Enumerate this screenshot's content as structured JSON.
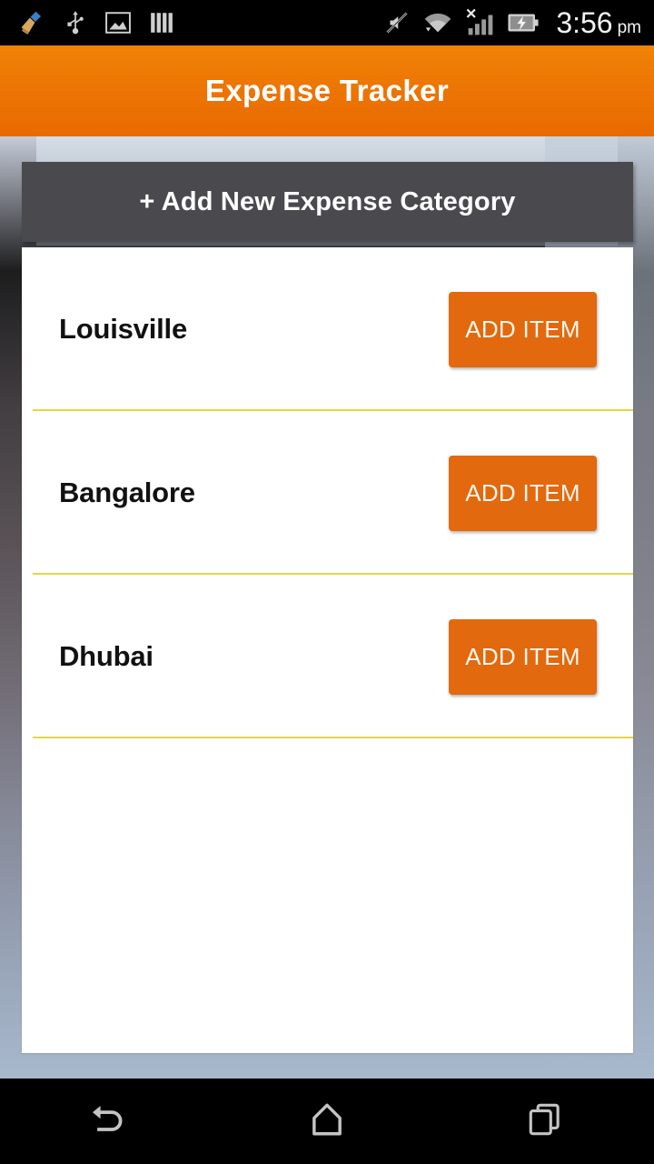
{
  "statusbar": {
    "left_icons": [
      {
        "name": "cleaner-broom-icon"
      },
      {
        "name": "usb-icon"
      },
      {
        "name": "image-gallery-icon"
      },
      {
        "name": "vertical-bars-icon"
      }
    ],
    "right_icons": [
      {
        "name": "mute-ringer-off-icon"
      },
      {
        "name": "wifi-icon"
      },
      {
        "name": "cellular-signal-no-sim-icon"
      },
      {
        "name": "battery-charging-icon"
      }
    ],
    "time": "3:56",
    "meridiem": "pm"
  },
  "appbar": {
    "title": "Expense Tracker"
  },
  "actions": {
    "add_category_label": "+ Add New Expense Category"
  },
  "categories": [
    {
      "name": "Louisville",
      "action_label": "ADD ITEM"
    },
    {
      "name": "Bangalore",
      "action_label": "ADD ITEM"
    },
    {
      "name": "Dhubai",
      "action_label": "ADD ITEM"
    }
  ],
  "navbar": {
    "back_label": "Back",
    "home_label": "Home",
    "recents_label": "Recent apps"
  },
  "colors": {
    "accent_orange": "#e96a00",
    "button_orange": "#e2690d",
    "dark_button": "#4a4a4e",
    "divider_yellow": "#e5d642",
    "statusbar_black": "#000000",
    "card_white": "#ffffff"
  }
}
